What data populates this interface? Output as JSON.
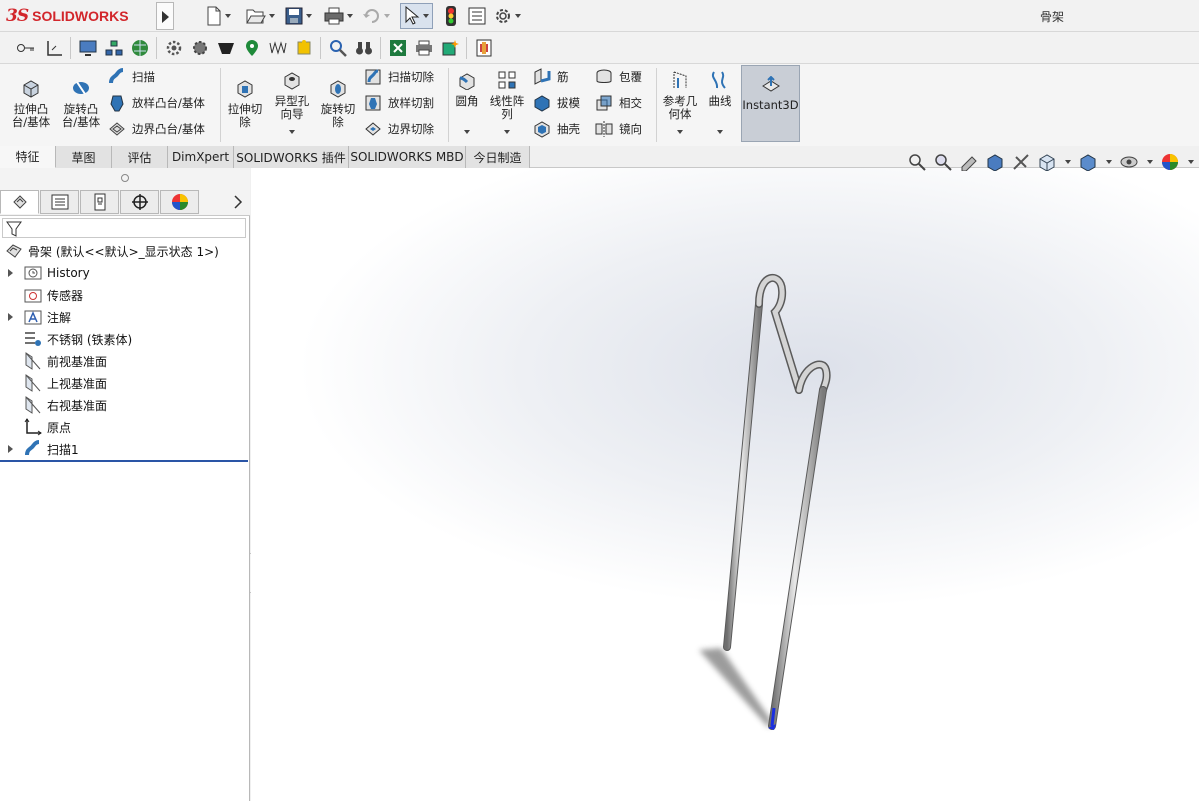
{
  "titlebar": {
    "logo_prefix": "3S",
    "logo_text": "SOLIDWORKS",
    "document_title": "骨架"
  },
  "quick_access": {
    "icons": [
      "new-document-icon",
      "open-folder-icon",
      "save-icon",
      "print-icon",
      "undo-icon",
      "select-arrow-icon",
      "rebuild-traffic-light-icon",
      "file-properties-icon",
      "options-gear-icon"
    ]
  },
  "ribbon": {
    "extrude_boss": "拉伸凸\n台/基体",
    "revolve_boss": "旋转凸\n台/基体",
    "sweep": "扫描",
    "loft_boss": "放样凸台/基体",
    "boundary_boss": "边界凸台/基体",
    "extrude_cut": "拉伸切\n除",
    "hole_wizard": "异型孔\n向导",
    "revolve_cut": "旋转切\n除",
    "swept_cut": "扫描切除",
    "lofted_cut": "放样切割",
    "boundary_cut": "边界切除",
    "fillet": "圆角",
    "linear_pattern": "线性阵\n列",
    "rib": "筋",
    "draft": "拔模",
    "shell": "抽壳",
    "wrap": "包覆",
    "intersect": "相交",
    "mirror": "镜向",
    "reference_geometry": "参考几\n何体",
    "curves": "曲线",
    "instant3d": "Instant3D"
  },
  "tabs": [
    {
      "label": "特征",
      "active": true
    },
    {
      "label": "草图",
      "active": false
    },
    {
      "label": "评估",
      "active": false
    },
    {
      "label": "DimXpert",
      "active": false
    },
    {
      "label": "SOLIDWORKS 插件",
      "active": false
    },
    {
      "label": "SOLIDWORKS MBD",
      "active": false
    },
    {
      "label": "今日制造",
      "active": false
    }
  ],
  "feature_tree": {
    "root": "骨架  (默认<<默认>_显示状态 1>)",
    "items": [
      {
        "label": "History",
        "icon": "history-icon",
        "expandable": true
      },
      {
        "label": "传感器",
        "icon": "sensor-icon",
        "expandable": false
      },
      {
        "label": "注解",
        "icon": "annotation-icon",
        "expandable": true
      },
      {
        "label": "不锈钢 (铁素体)",
        "icon": "material-icon",
        "expandable": false
      },
      {
        "label": "前视基准面",
        "icon": "plane-icon",
        "expandable": false
      },
      {
        "label": "上视基准面",
        "icon": "plane-icon",
        "expandable": false
      },
      {
        "label": "右视基准面",
        "icon": "plane-icon",
        "expandable": false
      },
      {
        "label": "原点",
        "icon": "origin-icon",
        "expandable": false
      },
      {
        "label": "扫描1",
        "icon": "sweep-feature-icon",
        "expandable": true
      }
    ]
  },
  "colors": {
    "brand_red": "#d2262b",
    "model_gray": "#bdbdbd",
    "tree_divider": "#2a55a6",
    "instant3d_active": "#c9ced6"
  }
}
